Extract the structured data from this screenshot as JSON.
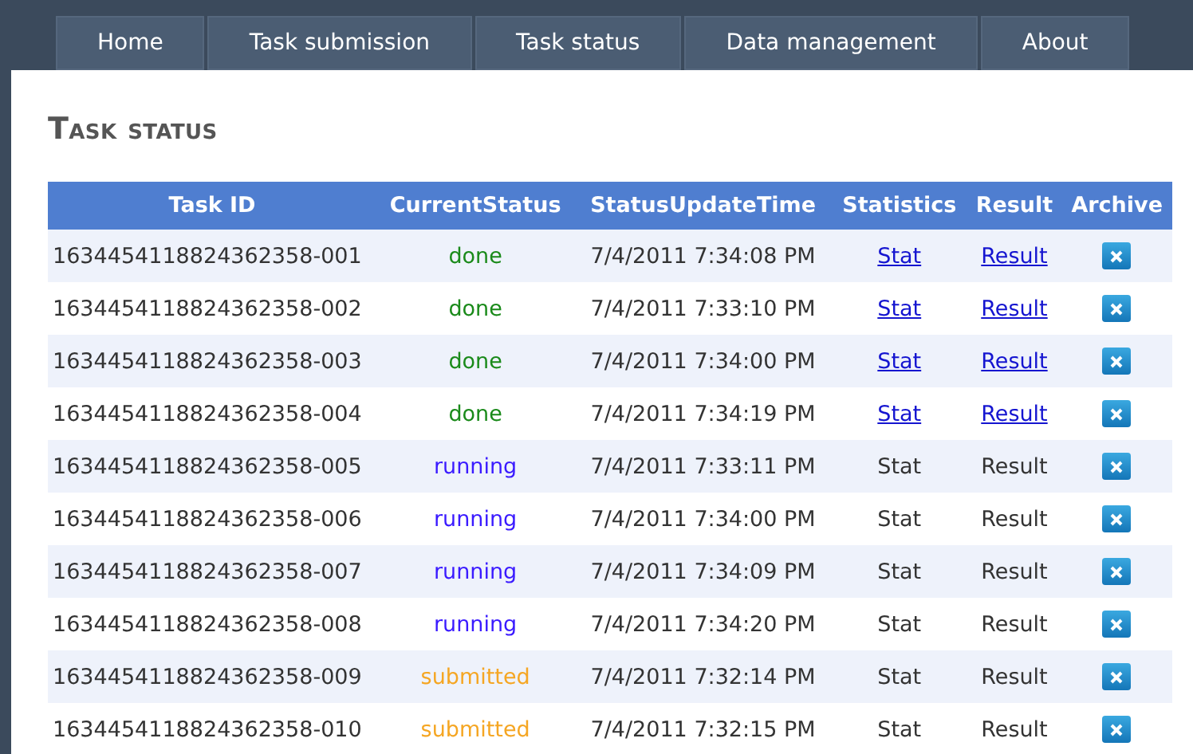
{
  "nav": [
    {
      "label": "Home",
      "selected": false
    },
    {
      "label": "Task submission",
      "selected": false
    },
    {
      "label": "Task status",
      "selected": false
    },
    {
      "label": "Data management",
      "selected": false
    },
    {
      "label": "About",
      "selected": false
    }
  ],
  "title": "Task status",
  "table": {
    "columns": [
      "Task ID",
      "CurrentStatus",
      "StatusUpdateTime",
      "Statistics",
      "Result",
      "Archive"
    ],
    "rows": [
      {
        "id": "1634454118824362358-001",
        "status": "done",
        "color": "#1a8a1a",
        "time": "7/4/2011 7:34:08 PM",
        "stat": "Stat",
        "result": "Result",
        "linked": true
      },
      {
        "id": "1634454118824362358-002",
        "status": "done",
        "color": "#1a8a1a",
        "time": "7/4/2011 7:33:10 PM",
        "stat": "Stat",
        "result": "Result",
        "linked": true
      },
      {
        "id": "1634454118824362358-003",
        "status": "done",
        "color": "#1a8a1a",
        "time": "7/4/2011 7:34:00 PM",
        "stat": "Stat",
        "result": "Result",
        "linked": true
      },
      {
        "id": "1634454118824362358-004",
        "status": "done",
        "color": "#1a8a1a",
        "time": "7/4/2011 7:34:19 PM",
        "stat": "Stat",
        "result": "Result",
        "linked": true
      },
      {
        "id": "1634454118824362358-005",
        "status": "running",
        "color": "#3a1aff",
        "time": "7/4/2011 7:33:11 PM",
        "stat": "Stat",
        "result": "Result",
        "linked": false
      },
      {
        "id": "1634454118824362358-006",
        "status": "running",
        "color": "#3a1aff",
        "time": "7/4/2011 7:34:00 PM",
        "stat": "Stat",
        "result": "Result",
        "linked": false
      },
      {
        "id": "1634454118824362358-007",
        "status": "running",
        "color": "#3a1aff",
        "time": "7/4/2011 7:34:09 PM",
        "stat": "Stat",
        "result": "Result",
        "linked": false
      },
      {
        "id": "1634454118824362358-008",
        "status": "running",
        "color": "#3a1aff",
        "time": "7/4/2011 7:34:20 PM",
        "stat": "Stat",
        "result": "Result",
        "linked": false
      },
      {
        "id": "1634454118824362358-009",
        "status": "submitted",
        "color": "#f5a623",
        "time": "7/4/2011 7:32:14 PM",
        "stat": "Stat",
        "result": "Result",
        "linked": false
      },
      {
        "id": "1634454118824362358-010",
        "status": "submitted",
        "color": "#f5a623",
        "time": "7/4/2011 7:32:15 PM",
        "stat": "Stat",
        "result": "Result",
        "linked": false
      }
    ]
  }
}
